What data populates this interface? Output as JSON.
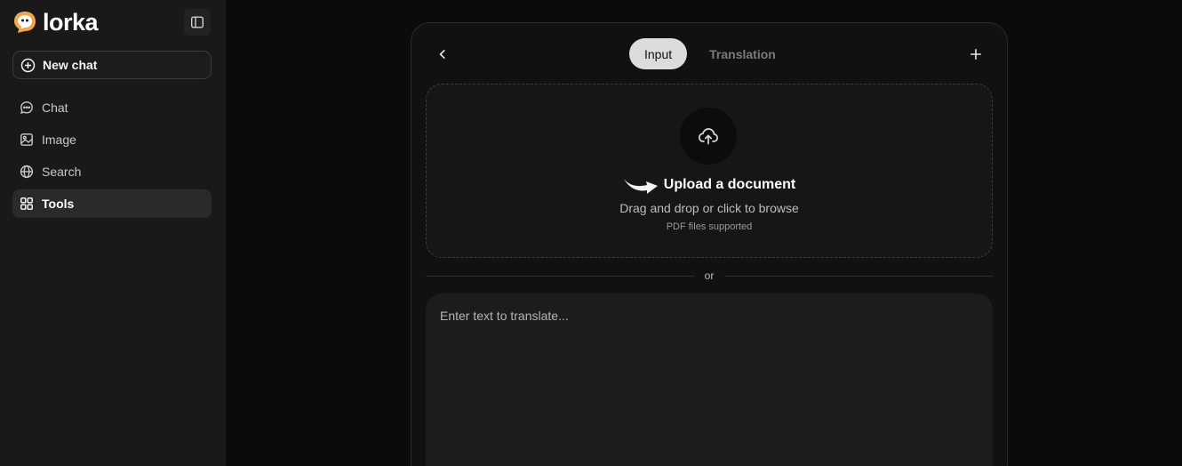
{
  "brand": {
    "name": "lorka",
    "accent": "#f7a540",
    "logo_icon": "lorka-logo"
  },
  "sidebar": {
    "collapse_icon": "sidebar-toggle-icon",
    "new_chat_label": "New chat",
    "items": [
      {
        "label": "Chat",
        "icon": "chat-bubble-icon",
        "active": false
      },
      {
        "label": "Image",
        "icon": "image-icon",
        "active": false
      },
      {
        "label": "Search",
        "icon": "globe-icon",
        "active": false
      },
      {
        "label": "Tools",
        "icon": "grid-icon",
        "active": true
      }
    ]
  },
  "main": {
    "tabs": [
      {
        "label": "Input",
        "active": true
      },
      {
        "label": "Translation",
        "active": false
      }
    ],
    "upload": {
      "title": "Upload a document",
      "subtitle": "Drag and drop or click to browse",
      "note": "PDF files supported"
    },
    "divider_text": "or",
    "text_input": {
      "placeholder": "Enter text to translate...",
      "value": ""
    }
  },
  "colors": {
    "background": "#0b0b0b",
    "sidebar": "#191919",
    "panel": "#111111",
    "active_tab": "#dcdcdc"
  }
}
